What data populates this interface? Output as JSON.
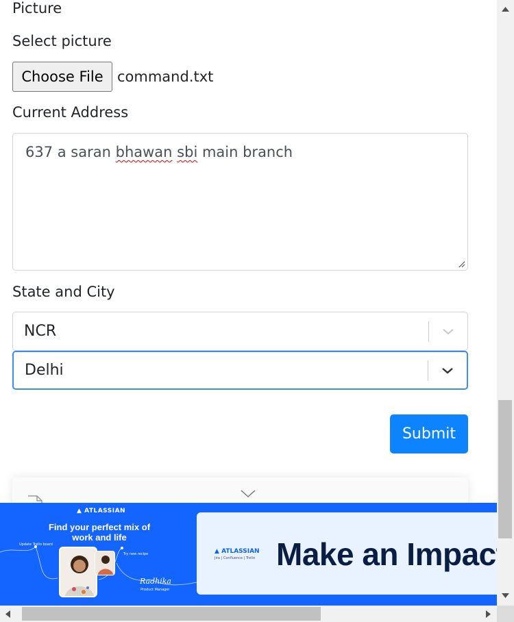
{
  "form": {
    "picture_heading": "Picture",
    "select_picture_label": "Select picture",
    "file_button_label": "Choose File",
    "file_name": "command.txt",
    "address_label": "Current Address",
    "address_value_parts": [
      "637 a saran ",
      "bhawan",
      " ",
      "sbi",
      " main branch"
    ],
    "state_city_label": "State and City",
    "state_value": "NCR",
    "city_value": "Delhi",
    "submit_label": "Submit"
  },
  "ad": {
    "brand": "ATLASSIAN",
    "headline": "Find your perfect mix of work and life",
    "note_update": "Update Trello board",
    "note_recipe": "Try new recipe",
    "signature": "Radhika",
    "role": "Product Manager",
    "right_brand": "ATLASSIAN",
    "right_products": "Jira | Confluence | Trello",
    "right_text": "Make an Impact"
  },
  "colors": {
    "accent": "#0d83fd",
    "focus_border": "#3b8bf0",
    "ad_blue": "#1464ff"
  }
}
